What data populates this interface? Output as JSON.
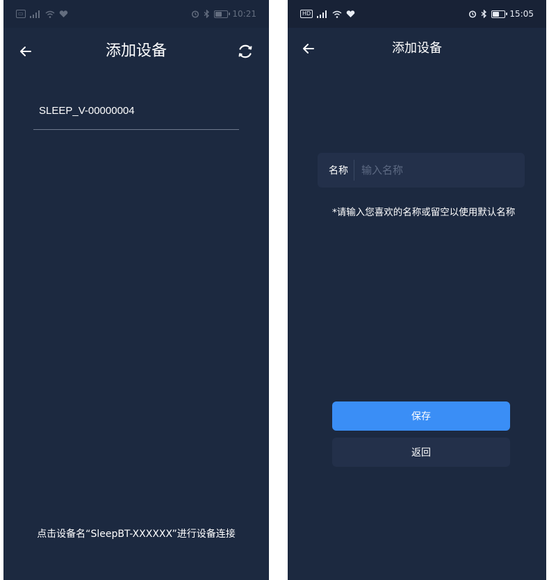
{
  "left_screen": {
    "status_bar": {
      "left_icons": [
        "sim-card-icon",
        "signal-icon",
        "wifi-icon",
        "heartbeat-icon"
      ],
      "right_icons": [
        "alarm-icon",
        "bluetooth-icon",
        "battery-icon"
      ],
      "time": "10:21",
      "battery_level": 0.6
    },
    "header": {
      "title": "添加设备",
      "back_icon": "arrow-left-icon",
      "refresh_icon": "refresh-icon"
    },
    "devices": [
      {
        "name": "SLEEP_V-00000004"
      }
    ],
    "hint": "点击设备名“SleepBT-XXXXXX”进行设备连接"
  },
  "right_screen": {
    "status_bar": {
      "left_icons": [
        "hd-icon",
        "signal-icon",
        "wifi-icon",
        "heartbeat-icon"
      ],
      "right_icons": [
        "alarm-icon",
        "bluetooth-icon",
        "battery-icon"
      ],
      "time": "15:05",
      "battery_level": 0.6
    },
    "header": {
      "title": "添加设备",
      "back_icon": "arrow-left-icon"
    },
    "name_field": {
      "label": "名称",
      "placeholder": "输入名称",
      "value": ""
    },
    "note": "*请输入您喜欢的名称或留空以使用默认名称",
    "save_label": "保存",
    "back_label": "返回"
  },
  "colors": {
    "screen_bg": "#1c2940",
    "status_bg": "#182236",
    "field_bg": "#23304a",
    "accent": "#3a8ef6"
  }
}
